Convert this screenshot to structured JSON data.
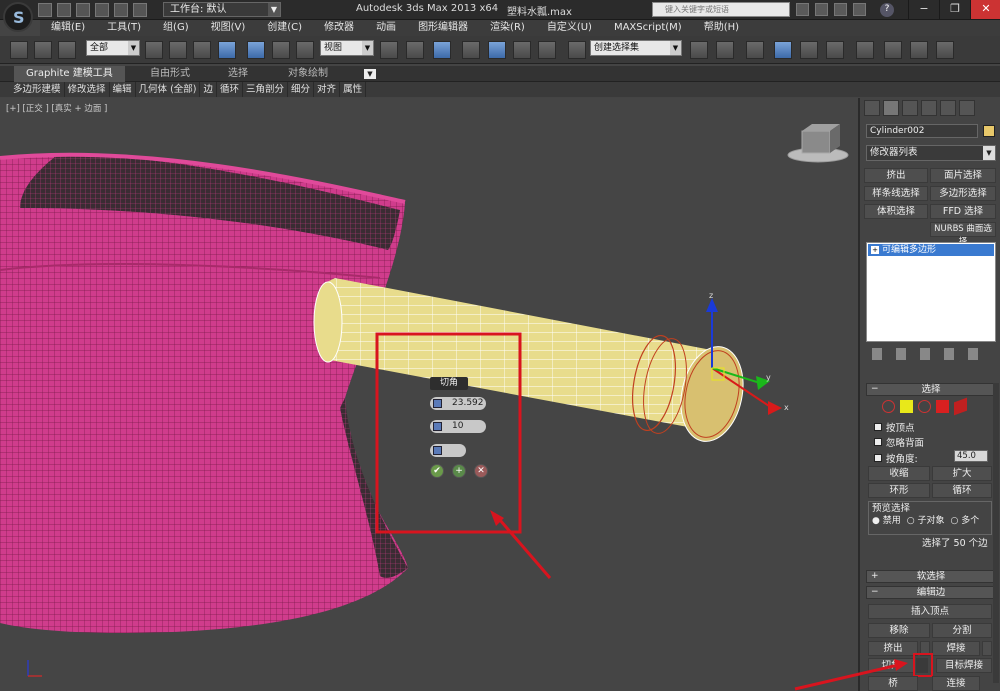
{
  "titlebar": {
    "workspace": "工作台: 默认",
    "app_title": "Autodesk 3ds Max  2013 x64",
    "file_name": "塑料水瓢.max",
    "search_placeholder": "键入关键字或短语",
    "help": "?"
  },
  "menu": [
    "编辑(E)",
    "工具(T)",
    "组(G)",
    "视图(V)",
    "创建(C)",
    "修改器",
    "动画",
    "图形编辑器",
    "渲染(R)",
    "自定义(U)",
    "MAXScript(M)",
    "帮助(H)"
  ],
  "toolbar": {
    "selection_filter": "全部",
    "ref_coord": "视图",
    "named_selection": "创建选择集"
  },
  "ribbon": {
    "tabs": [
      "Graphite 建模工具",
      "自由形式",
      "选择",
      "对象绘制"
    ],
    "sub_items": [
      "多边形建模",
      "修改选择",
      "编辑",
      "几何体 (全部)",
      "边",
      "循环",
      "三角剖分",
      "细分",
      "对齐",
      "属性"
    ]
  },
  "viewport": {
    "label": "[+] [正交 ] [真实 + 边面 ]",
    "axis_x": "x",
    "axis_y": "y",
    "axis_z": "z"
  },
  "caddy": {
    "title": "切角",
    "amount": "23.592",
    "segments": "10"
  },
  "panel": {
    "object_name": "Cylinder002",
    "object_color": "#e8c86a",
    "modifier_list": "修改器列表",
    "modifier_buttons": [
      "挤出",
      "面片选择",
      "样条线选择",
      "多边形选择",
      "体积选择",
      "FFD 选择",
      "NURBS 曲面选择"
    ],
    "stack_item": "可编辑多边形",
    "selection_header": "选择",
    "by_vertex": "按顶点",
    "ignore_backfacing": "忽略背面",
    "by_angle": "按角度:",
    "angle_value": "45.0",
    "shrink": "收缩",
    "grow": "扩大",
    "ring": "环形",
    "loop": "循环",
    "preview_selection": "预览选择",
    "preview_options": [
      "禁用",
      "子对象",
      "多个"
    ],
    "selection_count": "选择了 50 个边",
    "soft_selection": "软选择",
    "edit_edges": "编辑边",
    "insert_vertex": "插入顶点",
    "remove": "移除",
    "split": "分割",
    "extrude": "挤出",
    "weld": "焊接",
    "chamfer": "切角",
    "target_weld": "目标焊接",
    "bridge": "桥",
    "connect": "连接"
  },
  "colors": {
    "highlight_box": "#d8141e",
    "bowl": "#d33a8a",
    "handle": "#e8dc8c"
  }
}
